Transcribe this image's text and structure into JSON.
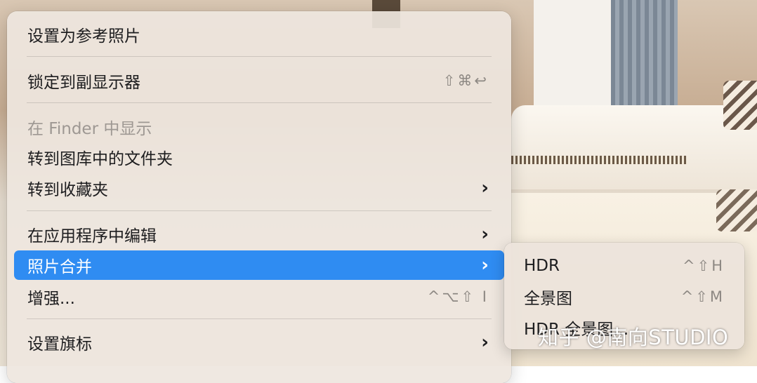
{
  "menu": {
    "items": [
      {
        "label": "设置为参考照片"
      },
      {
        "label": "锁定到副显示器",
        "shortcut": "⇧⌘↩"
      },
      {
        "label": "在 Finder 中显示"
      },
      {
        "label": "转到图库中的文件夹"
      },
      {
        "label": "转到收藏夹",
        "submenu_indicator": "›"
      },
      {
        "label": "在应用程序中编辑",
        "submenu_indicator": "›"
      },
      {
        "label": "照片合并",
        "submenu_indicator": "›"
      },
      {
        "label": "增强...",
        "shortcut": "^⌥⇧ I"
      },
      {
        "label": "设置旗标",
        "submenu_indicator": "›"
      }
    ]
  },
  "submenu": {
    "items": [
      {
        "label": "HDR",
        "shortcut": "^⇧H"
      },
      {
        "label": "全景图",
        "shortcut": "^⇧M"
      },
      {
        "label": "HDR 全景图..."
      }
    ]
  },
  "watermark": "知乎 @南向STUDIO",
  "colors": {
    "highlight": "#2f8cf2",
    "menu_bg": "#eee6de"
  }
}
